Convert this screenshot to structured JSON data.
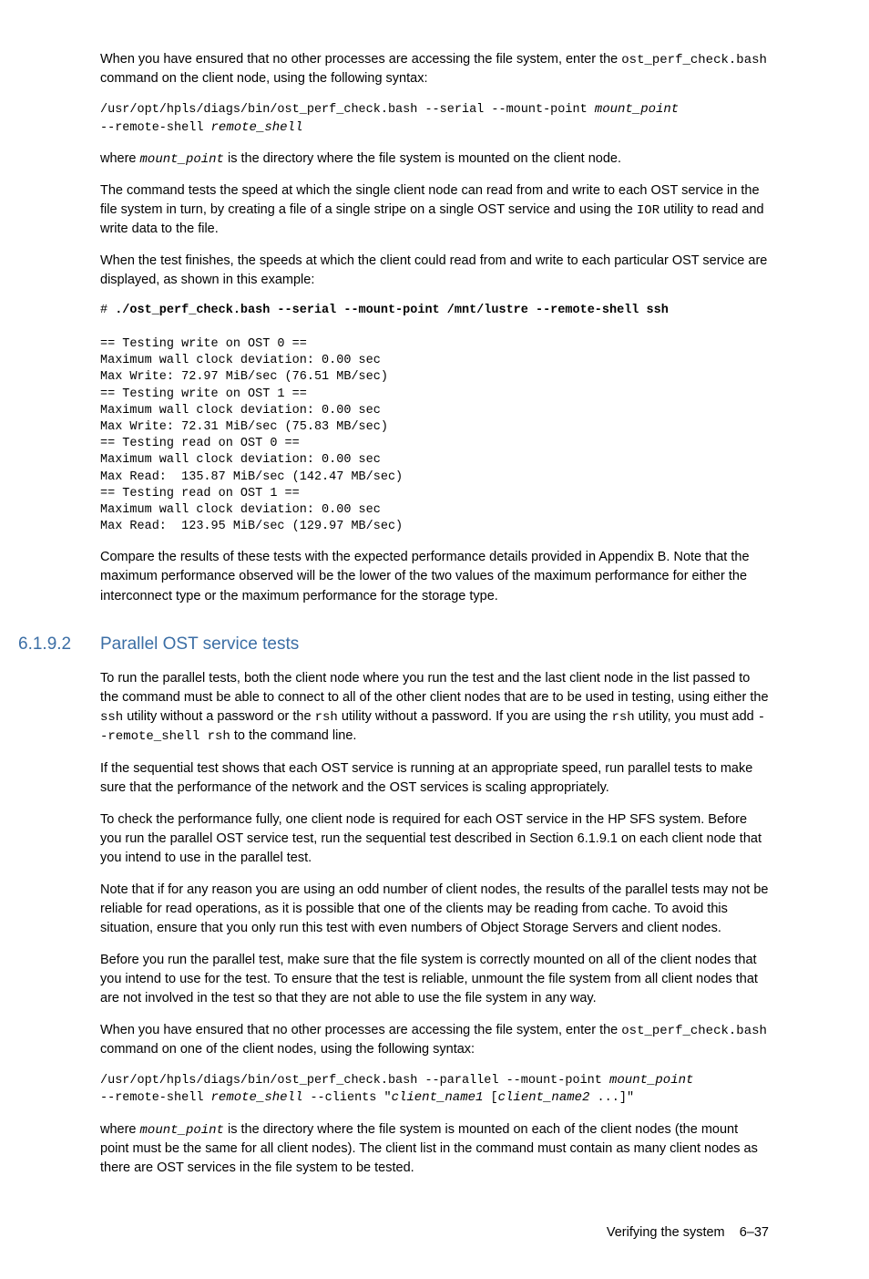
{
  "p1_pre": "When you have ensured that no other processes are accessing the file system, enter the ",
  "p1_code": "ost_perf_check.bash",
  "p1_post": " command on the client node, using the following syntax:",
  "cmd1_a": "/usr/opt/hpls/diags/bin/ost_perf_check.bash --serial --mount-point ",
  "cmd1_b": "mount_point",
  "cmd1_c": "\n--remote-shell ",
  "cmd1_d": "remote_shell",
  "p2_pre": "where ",
  "p2_code": "mount_point",
  "p2_post": " is the directory where the file system is mounted on the client node.",
  "p3_a": "The command tests the speed at which the single client node can read from and write to each OST service in the file system in turn, by creating a file of a single stripe on a single OST service and using the ",
  "p3_code": "IOR",
  "p3_b": " utility to read and write data to the file.",
  "p4": "When the test finishes, the speeds at which the client could read from and write to each particular OST service are displayed, as shown in this example:",
  "ex_prompt": "# ",
  "ex_cmd": "./ost_perf_check.bash --serial --mount-point /mnt/lustre --remote-shell ssh",
  "ex_body": "== Testing write on OST 0 ==\nMaximum wall clock deviation: 0.00 sec\nMax Write: 72.97 MiB/sec (76.51 MB/sec)\n== Testing write on OST 1 ==\nMaximum wall clock deviation: 0.00 sec\nMax Write: 72.31 MiB/sec (75.83 MB/sec)\n== Testing read on OST 0 ==\nMaximum wall clock deviation: 0.00 sec\nMax Read:  135.87 MiB/sec (142.47 MB/sec)\n== Testing read on OST 1 ==\nMaximum wall clock deviation: 0.00 sec\nMax Read:  123.95 MiB/sec (129.97 MB/sec)",
  "p5": "Compare the results of these tests with the expected performance details provided in Appendix B. Note that the maximum performance observed will be the lower of the two values of the maximum performance for either the interconnect type or the maximum performance for the storage type.",
  "sec_num": "6.1.9.2",
  "sec_title": "Parallel OST service tests",
  "p6_a": "To run the parallel tests, both the client node where you run the test and the last client node in the list passed to the command must be able to connect to all of the other client nodes that are to be used in testing, using either the ",
  "p6_ssh": "ssh",
  "p6_b": " utility without a password or the ",
  "p6_rsh": "rsh",
  "p6_c": " utility without a password. If you are using the ",
  "p6_rsh2": "rsh",
  "p6_d": " utility, you must add ",
  "p6_opt": "--remote_shell rsh",
  "p6_e": " to the command line.",
  "p7": "If the sequential test shows that each OST service is running at an appropriate speed, run parallel tests to make sure that the performance of the network and the OST services is scaling appropriately.",
  "p8": "To check the performance fully, one client node is required for each OST service in the HP SFS system. Before you run the parallel OST service test, run the sequential test described in Section 6.1.9.1 on each client node that you intend to use in the parallel test.",
  "p9": "Note that if for any reason you are using an odd number of client nodes, the results of the parallel tests may not be reliable for read operations, as it is possible that one of the clients may be reading from cache. To avoid this situation, ensure that you only run this test with even numbers of Object Storage Servers and client nodes.",
  "p10": "Before you run the parallel test, make sure that the file system is correctly mounted on all of the client nodes that you intend to use for the test. To ensure that the test is reliable, unmount the file system from all client nodes that are not involved in the test so that they are not able to use the file system in any way.",
  "p11_pre": "When you have ensured that no other processes are accessing the file system, enter the ",
  "p11_code": "ost_perf_check.bash",
  "p11_post": " command on one of the client nodes, using the following syntax:",
  "cmd2_a": "/usr/opt/hpls/diags/bin/ost_perf_check.bash --parallel --mount-point ",
  "cmd2_b": "mount_point",
  "cmd2_c": "\n--remote-shell ",
  "cmd2_d": "remote_shell",
  "cmd2_e": " --clients \"",
  "cmd2_f": "client_name1",
  "cmd2_g": " [",
  "cmd2_h": "client_name2",
  "cmd2_i": " ...]\"",
  "p12_pre": "where ",
  "p12_code": "mount_point",
  "p12_post": " is the directory where the file system is mounted on each of the client nodes (the mount point must be the same for all client nodes). The client list in the command must contain as many client nodes as there are OST services in the file system to be tested.",
  "footer_title": "Verifying the system",
  "footer_page": "6–37"
}
